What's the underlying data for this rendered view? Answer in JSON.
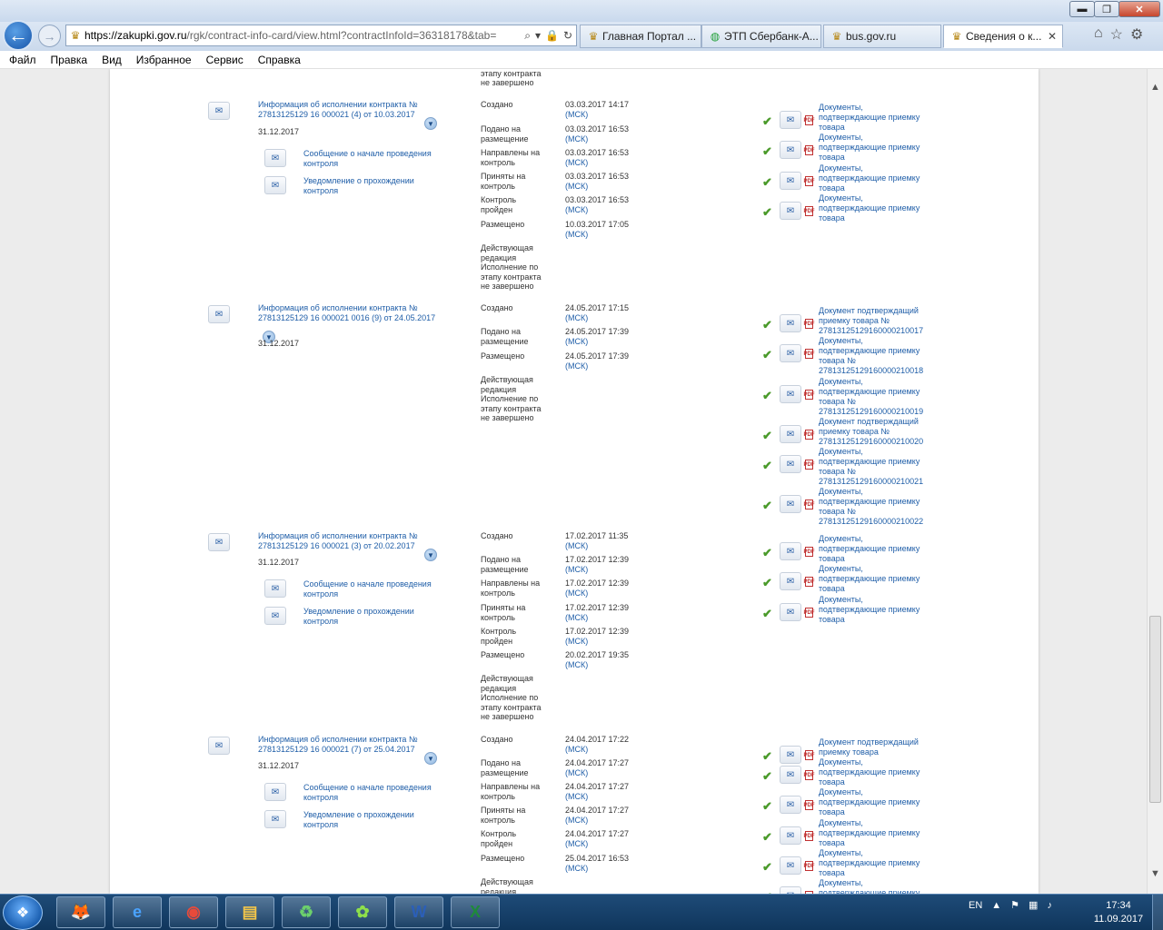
{
  "browser": {
    "url_main": "https://zakupki.gov.ru",
    "url_path": "/rgk/contract-info-card/view.html?contractInfoId=36318178&tab=",
    "tabs": [
      {
        "label": "Главная Портал ...",
        "icon": "emblem-icon"
      },
      {
        "label": "ЭТП Сбербанк-А...",
        "icon": "sberbank-icon"
      },
      {
        "label": "bus.gov.ru",
        "icon": "emblem-icon"
      },
      {
        "label": "Сведения о к...",
        "icon": "emblem-icon"
      }
    ],
    "window_controls": {
      "minimize": "▬",
      "maximize": "❐",
      "close": "✕"
    },
    "menu": [
      "Файл",
      "Правка",
      "Вид",
      "Избранное",
      "Сервис",
      "Справка"
    ]
  },
  "top_partial": {
    "status": "Исполнение по этапу контракта не завершено"
  },
  "records": [
    {
      "title": "Информация об исполнении контракта № 27813125129 16 000021 (4) от 10.03.2017",
      "date": "31.12.2017",
      "sublinks": [
        "Сообщение о начале проведения контроля",
        "Уведомление о прохождении контроля"
      ],
      "events": [
        {
          "label": "Создано",
          "date": "03.03.2017 14:17",
          "tz": "(МСК)"
        },
        {
          "label": "Подано на размещение",
          "date": "03.03.2017 16:53",
          "tz": "(МСК)"
        },
        {
          "label": "Направлены на контроль",
          "date": "03.03.2017 16:53",
          "tz": "(МСК)"
        },
        {
          "label": "Приняты на контроль",
          "date": "03.03.2017 16:53",
          "tz": "(МСК)"
        },
        {
          "label": "Контроль пройден",
          "date": "03.03.2017 16:53",
          "tz": "(МСК)"
        },
        {
          "label": "Размещено",
          "date": "10.03.2017 17:05",
          "tz": "(МСК)"
        },
        {
          "label": "Действующая редакция Исполнение по этапу контракта не завершено",
          "date": "",
          "tz": ""
        }
      ],
      "docs": [
        "Документы, подтверждающие приемку товара",
        "Документы, подтверждающие приемку товара",
        "Документы, подтверждающие приемку товара",
        "Документы, подтверждающие приемку товара"
      ]
    },
    {
      "title": "Информация об исполнении контракта № 27813125129 16 000021 0016 (9) от 24.05.2017",
      "date": "31.12.2017",
      "sublinks": [],
      "events": [
        {
          "label": "Создано",
          "date": "24.05.2017 17:15",
          "tz": "(МСК)"
        },
        {
          "label": "Подано на размещение",
          "date": "24.05.2017 17:39",
          "tz": "(МСК)"
        },
        {
          "label": "Размещено",
          "date": "24.05.2017 17:39",
          "tz": "(МСК)"
        },
        {
          "label": "Действующая редакция Исполнение по этапу контракта не завершено",
          "date": "",
          "tz": ""
        }
      ],
      "docs": [
        "Документ подтверждащий приемку товара № 27813125129160000210017",
        "Документы, подтверждающие приемку товара № 27813125129160000210018",
        "Документы, подтверждающие приемку товара № 27813125129160000210019",
        "Документ подтверждащий приемку товара № 27813125129160000210020",
        "Документы, подтверждающие приемку товара № 27813125129160000210021",
        "Документы, подтверждающие приемку товара № 27813125129160000210022"
      ]
    },
    {
      "title": "Информация об исполнении контракта № 27813125129 16 000021 (3) от 20.02.2017",
      "date": "31.12.2017",
      "sublinks": [
        "Сообщение о начале проведения контроля",
        "Уведомление о прохождении контроля"
      ],
      "events": [
        {
          "label": "Создано",
          "date": "17.02.2017 11:35",
          "tz": "(МСК)"
        },
        {
          "label": "Подано на размещение",
          "date": "17.02.2017 12:39",
          "tz": "(МСК)"
        },
        {
          "label": "Направлены на контроль",
          "date": "17.02.2017 12:39",
          "tz": "(МСК)"
        },
        {
          "label": "Приняты на контроль",
          "date": "17.02.2017 12:39",
          "tz": "(МСК)"
        },
        {
          "label": "Контроль пройден",
          "date": "17.02.2017 12:39",
          "tz": "(МСК)"
        },
        {
          "label": "Размещено",
          "date": "20.02.2017 19:35",
          "tz": "(МСК)"
        },
        {
          "label": "Действующая редакция Исполнение по этапу контракта не завершено",
          "date": "",
          "tz": ""
        }
      ],
      "docs": [
        "Документы, подтверждающие приемку товара",
        "Документы, подтверждающие приемку товара",
        "Документы, подтверждающие приемку товара"
      ]
    },
    {
      "title": "Информация об исполнении контракта № 27813125129 16 000021 (7) от 25.04.2017",
      "date": "31.12.2017",
      "sublinks": [
        "Сообщение о начале проведения контроля",
        "Уведомление о прохождении контроля"
      ],
      "events": [
        {
          "label": "Создано",
          "date": "24.04.2017 17:22",
          "tz": "(МСК)"
        },
        {
          "label": "Подано на размещение",
          "date": "24.04.2017 17:27",
          "tz": "(МСК)"
        },
        {
          "label": "Направлены на контроль",
          "date": "24.04.2017 17:27",
          "tz": "(МСК)"
        },
        {
          "label": "Приняты на контроль",
          "date": "24.04.2017 17:27",
          "tz": "(МСК)"
        },
        {
          "label": "Контроль пройден",
          "date": "24.04.2017 17:27",
          "tz": "(МСК)"
        },
        {
          "label": "Размещено",
          "date": "25.04.2017 16:53",
          "tz": "(МСК)"
        },
        {
          "label": "Действующая редакция",
          "date": "",
          "tz": ""
        }
      ],
      "docs": [
        "Документ подтверждащий приемку товара",
        "Документы, подтверждающие приемку товара",
        "Документы, подтверждающие приемку товара",
        "Документы, подтверждающие приемку товара",
        "Документы, подтверждающие приемку товара",
        "Документы, подтверждающие приемку товара"
      ]
    }
  ],
  "taskbar": {
    "apps": [
      "Firefox",
      "Internet Explorer",
      "Chrome",
      "Explorer",
      "Recycle",
      "ICQ",
      "Word",
      "Excel"
    ],
    "lang": "EN",
    "time": "17:34",
    "date": "11.09.2017"
  }
}
